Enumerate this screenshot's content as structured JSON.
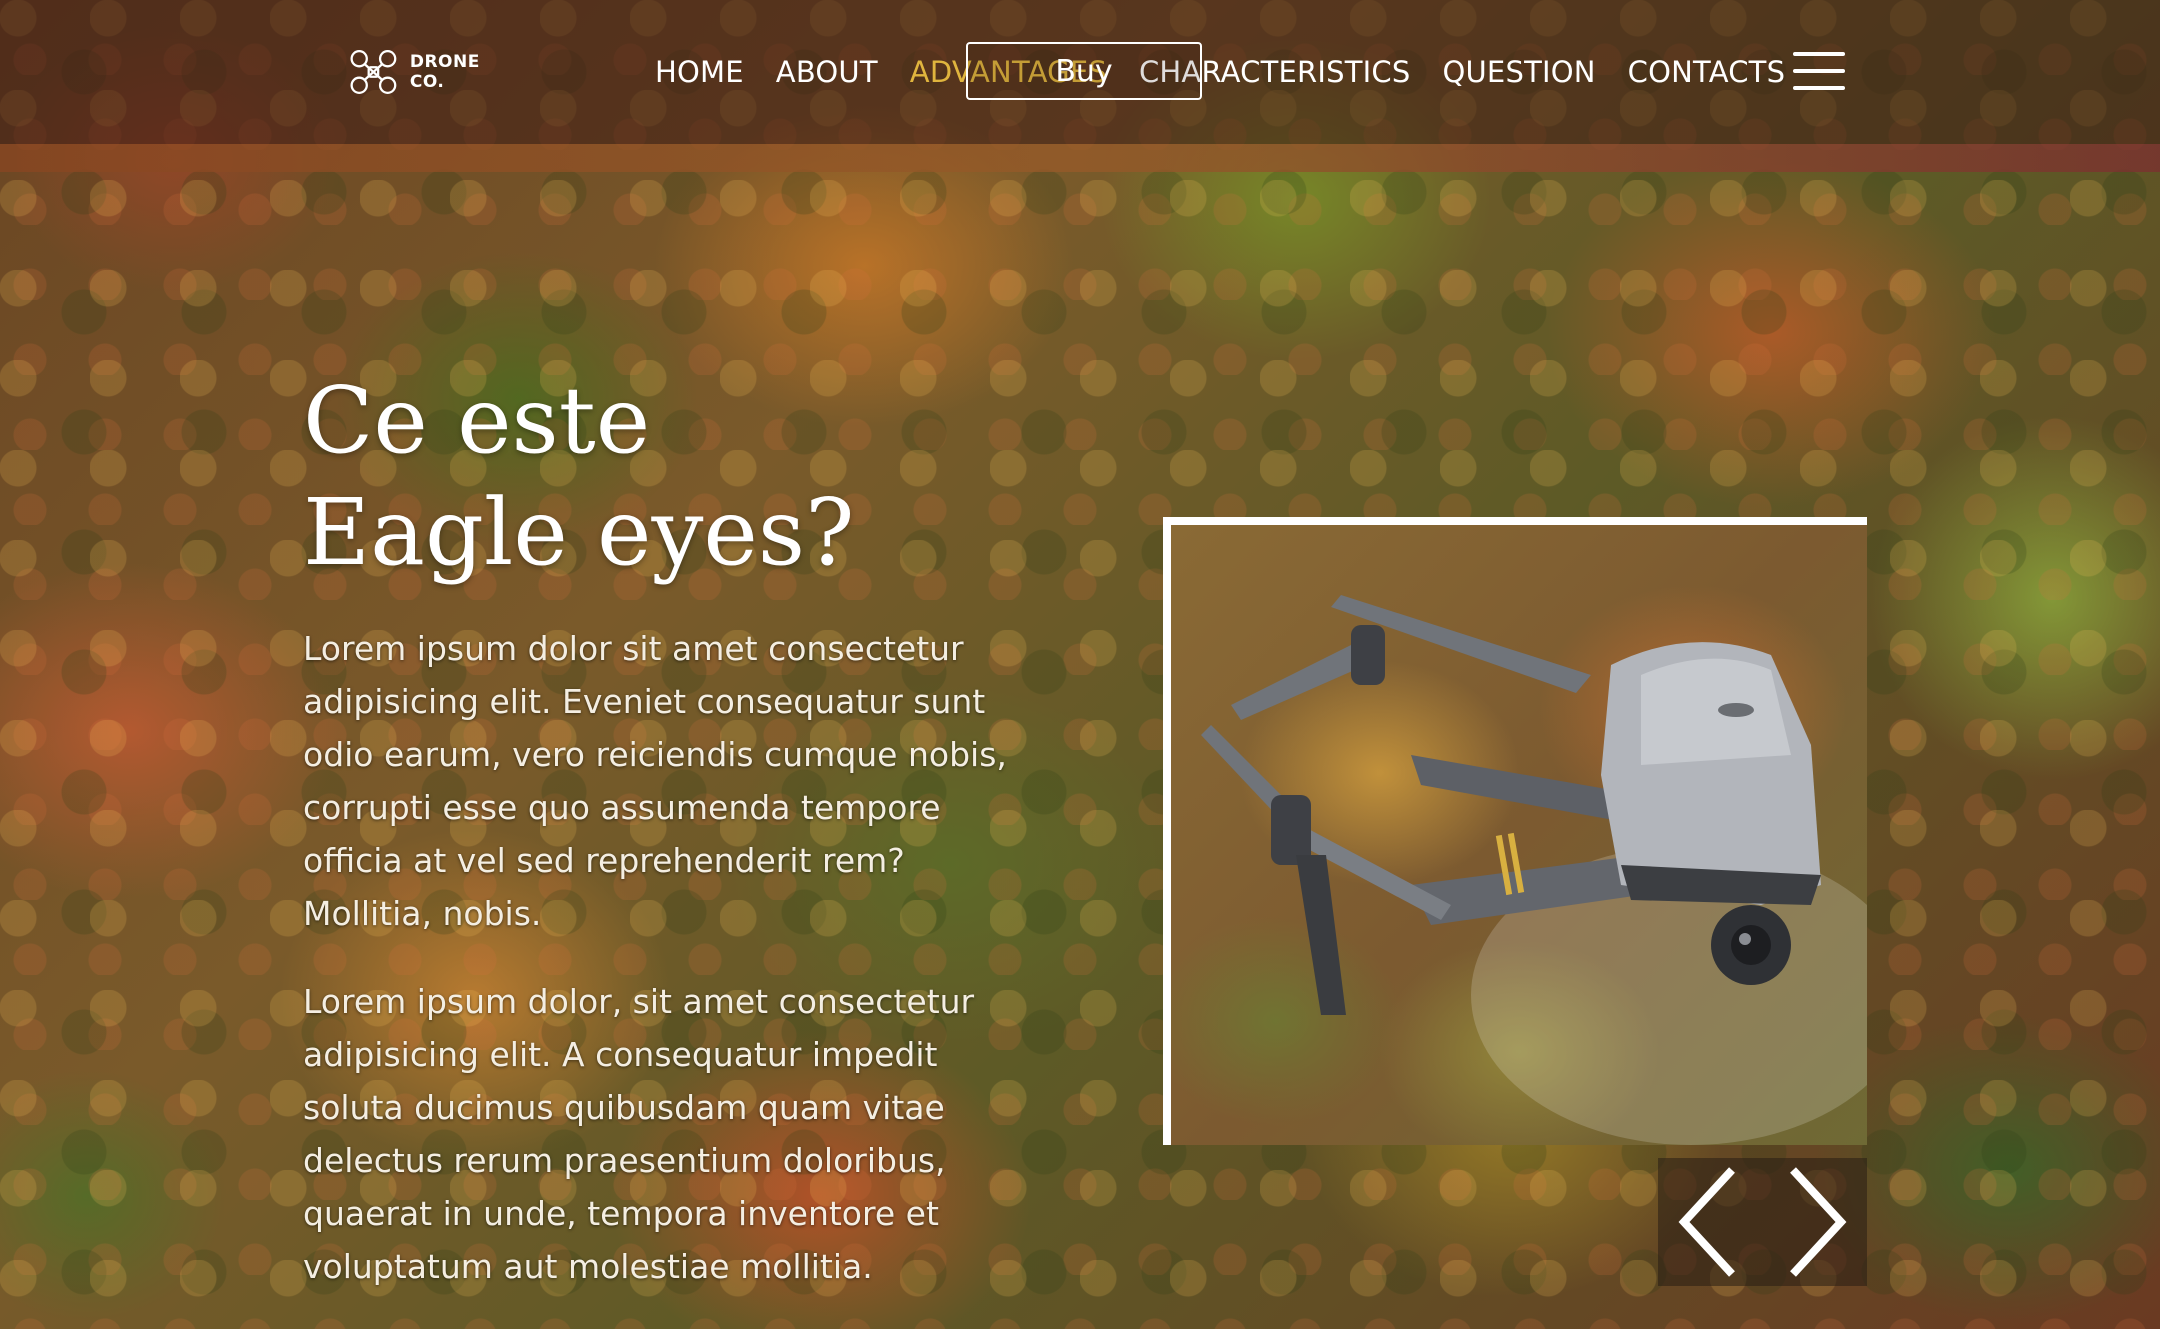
{
  "logo": {
    "text": "DRONE CO.",
    "icon": "drone-logo-icon"
  },
  "nav": {
    "items": [
      {
        "label": "HOME",
        "active": false
      },
      {
        "label": "ABOUT",
        "active": false
      },
      {
        "label": "ADVANTAGES",
        "active": true
      },
      {
        "label": "CHARACTERISTICS",
        "active": false
      },
      {
        "label": "QUESTION",
        "active": false
      },
      {
        "label": "CONTACTS",
        "active": false
      }
    ],
    "buy_label": "Buy",
    "menu_icon": "hamburger-menu-icon"
  },
  "hero": {
    "heading": "Ce este Eagle eyes?",
    "paragraph_1": "Lorem ipsum dolor sit amet consectetur adipisicing elit. Eveniet consequatur sunt odio earum, vero reiciendis cumque nobis, corrupti esse quo assumenda tempore officia at vel sed reprehenderit rem? Mollitia, nobis.",
    "paragraph_2": "Lorem ipsum dolor, sit amet consectetur adipisicing elit. A consequatur impedit soluta ducimus quibusdam quam vitae delectus rerum praesentium doloribus, quaerat in unde, tempora inventore et voluptatum aut molestiae mollitia."
  },
  "slider": {
    "prev_icon": "chevron-left-icon",
    "next_icon": "chevron-right-icon"
  },
  "colors": {
    "accent": "#e0b53e",
    "text": "#ffffff"
  }
}
